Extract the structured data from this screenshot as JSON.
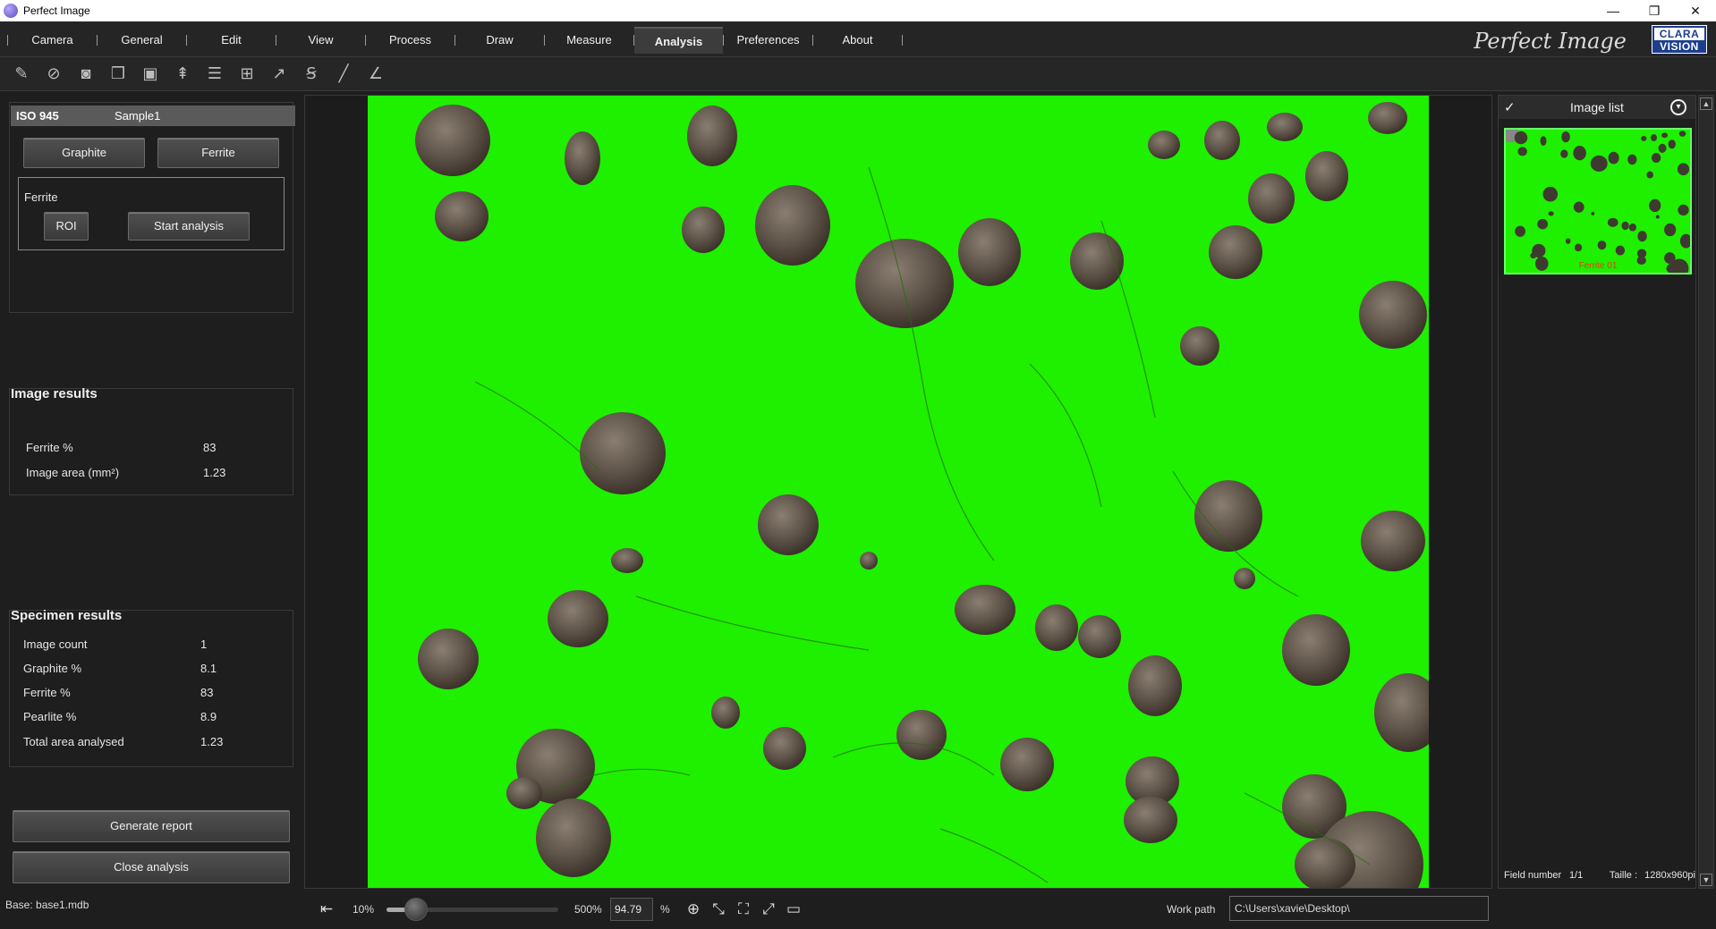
{
  "window": {
    "title": "Perfect Image",
    "minimize": "—",
    "restore": "❐",
    "close": "✕"
  },
  "menu": {
    "items": [
      "Camera",
      "General",
      "Edit",
      "View",
      "Process",
      "Draw",
      "Measure",
      "Analysis",
      "Preferences",
      "About"
    ],
    "active": "Analysis",
    "brand": "Perfect Image",
    "logo_top": "CLARA",
    "logo_bottom": "VISION"
  },
  "toolbar": {
    "icons": [
      "edit-icon",
      "no-camera-icon",
      "camera-icon",
      "images-icon",
      "save-icon",
      "layers-up-icon",
      "stack-icon",
      "grid-add-icon",
      "arrow-icon",
      "text-size-icon",
      "line-icon",
      "angle-icon"
    ]
  },
  "left": {
    "standard": "ISO 945",
    "sample": "Sample1",
    "graphite_btn": "Graphite",
    "ferrite_btn": "Ferrite",
    "group_label": "Ferrite",
    "roi_btn": "ROI",
    "start_btn": "Start analysis",
    "image_results": {
      "title": "Image results",
      "rows": [
        {
          "label": "Ferrite %",
          "value": "83"
        },
        {
          "label": "Image area (mm²)",
          "value": "1.23"
        }
      ]
    },
    "specimen_results": {
      "title": "Specimen results",
      "rows": [
        {
          "label": "Image count",
          "value": "1"
        },
        {
          "label": "Graphite %",
          "value": "8.1"
        },
        {
          "label": "Ferrite %",
          "value": "83"
        },
        {
          "label": "Pearlite %",
          "value": "8.9"
        },
        {
          "label": "Total area analysed",
          "value": "1.23"
        }
      ]
    },
    "generate_report": "Generate report",
    "close_analysis": "Close analysis",
    "base": "Base: base1.mdb"
  },
  "zoom": {
    "min_label": "10%",
    "max_label": "500%",
    "value": "94.79",
    "unit": "%",
    "slider_fraction": 0.17
  },
  "workpath": {
    "label": "Work path",
    "value": "C:\\Users\\xavie\\Desktop\\"
  },
  "image_list": {
    "title": "Image list",
    "thumb_label": "Ferrite 01",
    "field_label": "Field number",
    "field_value": "1/1",
    "size_label": "Taille :",
    "size_value": "1280x960pi"
  },
  "colors": {
    "overlay_green": "#1ef000",
    "nodule_brown": "#5e5348",
    "thumb_label": "#e63c1a"
  }
}
